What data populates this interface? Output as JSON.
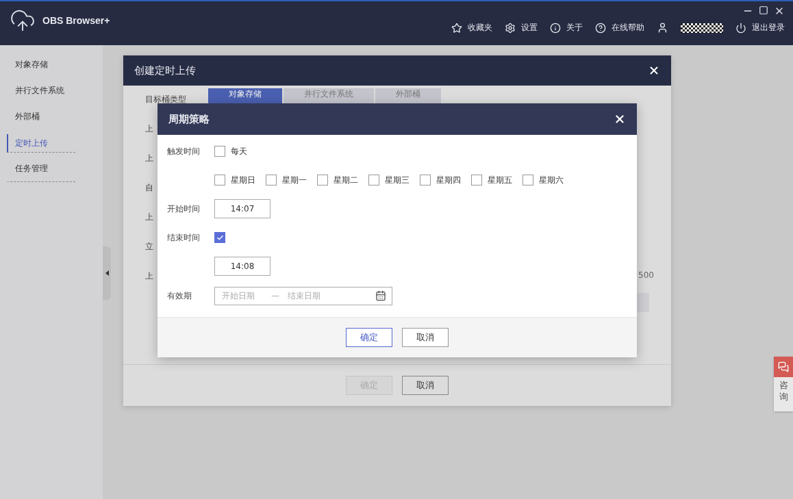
{
  "app": {
    "title": "OBS Browser+",
    "nav": [
      {
        "kind": "favorites",
        "label": "收藏夹"
      },
      {
        "kind": "settings",
        "label": "设置"
      },
      {
        "kind": "about",
        "label": "关于"
      },
      {
        "kind": "help",
        "label": "在线帮助"
      }
    ],
    "logout": "退出登录"
  },
  "sidebar": {
    "items": [
      {
        "label": "对象存储",
        "selected": false
      },
      {
        "label": "并行文件系统",
        "selected": false
      },
      {
        "label": "外部桶",
        "selected": false
      },
      {
        "label": "定时上传",
        "selected": true
      },
      {
        "label": "任务管理",
        "selected": false
      }
    ]
  },
  "create_dialog": {
    "title": "创建定时上传",
    "rows": [
      {
        "label": "目标桶类型",
        "tabs": [
          {
            "label": "对象存储",
            "selected": true
          },
          {
            "label": "并行文件系统",
            "selected": false
          },
          {
            "label": "外部桶",
            "selected": false
          }
        ]
      },
      {
        "label": "上"
      },
      {
        "label": "上"
      },
      {
        "label": "自"
      },
      {
        "label": "上"
      },
      {
        "label": "立"
      },
      {
        "label": "上",
        "trailing": "500"
      },
      {
        "label": "",
        "strip": true
      }
    ],
    "buttons": [
      {
        "label": "确定",
        "disabled": true
      },
      {
        "label": "取消",
        "disabled": false
      }
    ]
  },
  "cycle_dialog": {
    "title": "周期策略",
    "trigger_label": "触发时间",
    "every_day": {
      "label": "每天",
      "checked": false
    },
    "weekdays": [
      {
        "label": "星期日",
        "checked": false
      },
      {
        "label": "星期一",
        "checked": false
      },
      {
        "label": "星期二",
        "checked": false
      },
      {
        "label": "星期三",
        "checked": false
      },
      {
        "label": "星期四",
        "checked": false
      },
      {
        "label": "星期五",
        "checked": false
      },
      {
        "label": "星期六",
        "checked": false
      }
    ],
    "start_label": "开始时间",
    "start_time": "14:07",
    "end_label": "结束时间",
    "end_enabled": true,
    "end_time": "14:08",
    "validity_label": "有效期",
    "validity_start_placeholder": "开始日期",
    "validity_separator": "—",
    "validity_end_placeholder": "结束日期",
    "buttons": [
      {
        "label": "确定",
        "primary": true
      },
      {
        "label": "取消",
        "primary": false
      }
    ]
  },
  "consult": {
    "label": "咨询"
  }
}
